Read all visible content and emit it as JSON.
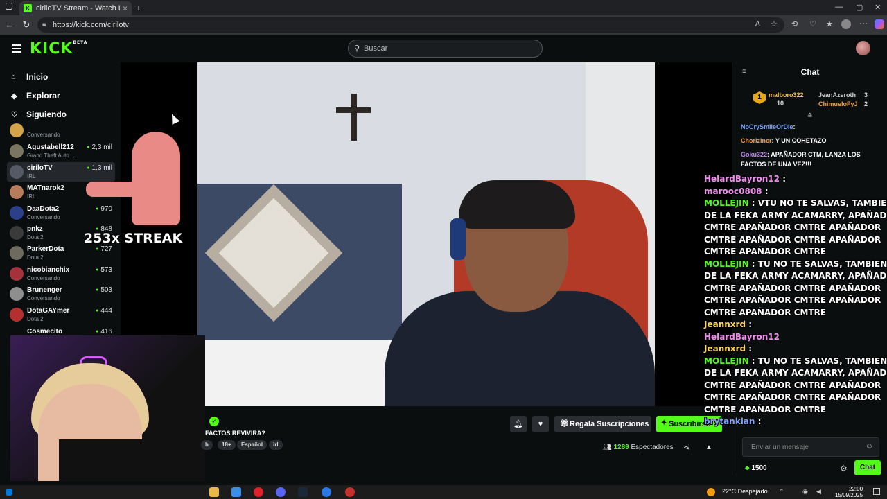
{
  "browser": {
    "tab_title": "ciriloTV Stream - Watch Live on K",
    "tab_favicon": "K",
    "url": "https://kick.com/cirilotv"
  },
  "site": {
    "logo": "KICK",
    "logo_badge": "BETA",
    "search_placeholder": "Buscar",
    "accent_color": "#53fc18"
  },
  "sidebar": {
    "nav": [
      {
        "label": "Inicio",
        "icon": "home-icon"
      },
      {
        "label": "Explorar",
        "icon": "compass-icon"
      },
      {
        "label": "Siguiendo",
        "icon": "heart-icon"
      }
    ],
    "channels": [
      {
        "name": "",
        "category": "Conversando",
        "viewers": ""
      },
      {
        "name": "Agustabell212",
        "category": "Grand Theft Auto ...",
        "viewers": "2,3 mil"
      },
      {
        "name": "ciriloTV",
        "category": "IRL",
        "viewers": "1,3 mil"
      },
      {
        "name": "MATnarok2",
        "category": "IRL",
        "viewers": ""
      },
      {
        "name": "DaaDota2",
        "category": "Conversando",
        "viewers": "970"
      },
      {
        "name": "pnkz",
        "category": "Dota 2",
        "viewers": "848"
      },
      {
        "name": "ParkerDota",
        "category": "Dota 2",
        "viewers": "727"
      },
      {
        "name": "nicobianchix",
        "category": "Conversando",
        "viewers": "573"
      },
      {
        "name": "Brunenger",
        "category": "Conversando",
        "viewers": "503"
      },
      {
        "name": "DotaGAYmer",
        "category": "Dota 2",
        "viewers": "444"
      },
      {
        "name": "Cosmecito",
        "category": "",
        "viewers": "416"
      }
    ]
  },
  "stream": {
    "overlay_streak": "253x STREAK",
    "title": "FACTOS REVIVIRA?",
    "tags": [
      "h",
      "18+",
      "Español",
      "irl"
    ],
    "viewers_count": "1289",
    "viewers_label": "Espectadores",
    "gift_button": "Regala Suscripciones",
    "subscribe_button": "Suscribirse"
  },
  "chat": {
    "title": "Chat",
    "leaderboard": [
      {
        "rank": "1",
        "name": "malboro322",
        "count": "10"
      },
      {
        "name": "JeanAzeroth",
        "count": "3"
      },
      {
        "name": "ChimueloFyJ",
        "count": "2"
      }
    ],
    "messages": [
      {
        "user": "NoCrySmileOrDie",
        "text": ":"
      },
      {
        "user": "Chorizincr",
        "text": ": Y UN COHETAZO"
      },
      {
        "user": "Goku322",
        "text": ": APAÑADOR CTM, LANZA LOS"
      },
      {
        "user": "",
        "text": "FACTOS DE UNA VEZ!!!"
      }
    ],
    "overlay_lines": [
      {
        "user": "HelardBayron12",
        "text": " :"
      },
      {
        "user": "marooc0808",
        "text": " :"
      },
      {
        "user": "MOLLEJIN",
        "text": " : VTU NO TE SALVAS, TAMBIEN ERES"
      },
      {
        "user": "",
        "text": "DE LA FEKA ARMY ACAMARRY, APAÑADOR"
      },
      {
        "user": "",
        "text": "CMTRE    APAÑADOR CMTRE    APAÑADOR"
      },
      {
        "user": "",
        "text": "CMTRE    APAÑADOR CMTRE    APAÑADOR"
      },
      {
        "user": "",
        "text": "CMTRE    APAÑADOR CMTRE"
      },
      {
        "user": "MOLLEJIN",
        "text": " : TU NO TE SALVAS, TAMBIEN ERES"
      },
      {
        "user": "",
        "text": "DE LA FEKA ARMY ACAMARRY, APAÑADOR"
      },
      {
        "user": "",
        "text": "CMTRE    APAÑADOR CMTRE    APAÑADOR"
      },
      {
        "user": "",
        "text": "CMTRE    APAÑADOR CMTRE    APAÑADOR"
      },
      {
        "user": "",
        "text": "CMTRE    APAÑADOR CMTRE"
      },
      {
        "user": "Jeannxrd",
        "text": " :"
      },
      {
        "user": "HelardBayron12",
        "text": ""
      },
      {
        "user": "Jeannxrd",
        "text": " :"
      },
      {
        "user": "MOLLEJIN",
        "text": " : TU NO TE SALVAS, TAMBIEN ERES"
      },
      {
        "user": "",
        "text": "DE LA FEKA ARMY ACAMARRY, APAÑADOR"
      },
      {
        "user": "",
        "text": "CMTRE    APAÑADOR CMTRE    APAÑADOR"
      },
      {
        "user": "",
        "text": "CMTRE    APAÑADOR CMTRE    APAÑADOR"
      },
      {
        "user": "",
        "text": "CMTRE    APAÑADOR CMTRE"
      },
      {
        "user": "brytankian",
        "text": " :"
      }
    ],
    "input_placeholder": "Enviar un mensaje",
    "points": "1500",
    "send_button": "Chat"
  },
  "taskbar": {
    "temperature": "22°C",
    "weather": "Despejado",
    "time": "22:00",
    "date": "15/09/2025"
  }
}
